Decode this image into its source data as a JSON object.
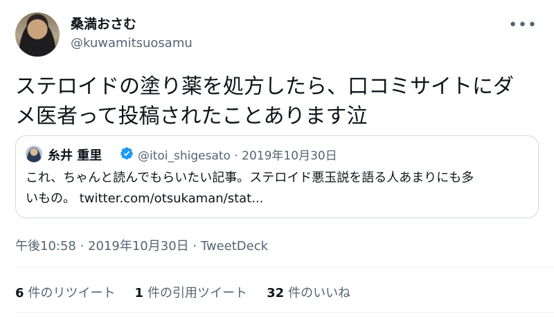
{
  "author": {
    "name": "桑満おさむ",
    "handle": "@kuwamitsuosamu"
  },
  "tweet": {
    "text_line1": "ステロイドの塗り薬を処方したら、口コミサイトにダ",
    "text_line2": "メ医者って投稿されたことあります泣"
  },
  "quoted": {
    "name": "糸井 重里",
    "handle_date": "@itoi_shigesato · 2019年10月30日",
    "text_line1": "これ、ちゃんと読んでもらいたい記事。ステロイド悪玉説を語る人あまりにも多",
    "text_line2_prefix": "いもの。 ",
    "link": "twitter.com/otsukaman/stat..."
  },
  "meta": {
    "time_date": "午後10:58 · 2019年10月30日 · ",
    "source": "TweetDeck"
  },
  "stats": {
    "retweets_count": "6",
    "retweets_label": "件のリツイート",
    "quotes_count": "1",
    "quotes_label": "件の引用ツイート",
    "likes_count": "32",
    "likes_label": "件のいいね"
  },
  "icons": {
    "more": "more-icon",
    "verified": "verified-badge-icon",
    "verified_color": "#1d9bf0"
  }
}
